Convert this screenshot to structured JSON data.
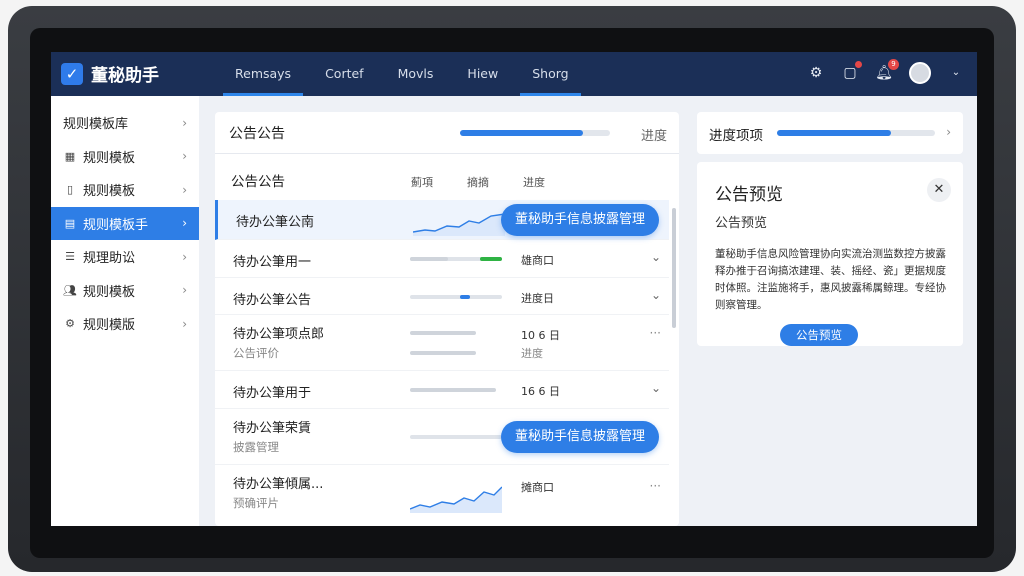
{
  "window_controls": [
    "–",
    "☐",
    "✕"
  ],
  "app": {
    "name": "董秘助手",
    "logo_icon": "check-logo-icon"
  },
  "nav": {
    "tabs": [
      "Remsays",
      "Cortef",
      "Movls",
      "Hiew",
      "Shorg"
    ]
  },
  "top_icons": {
    "notification_count": "9"
  },
  "sidebar": {
    "items": [
      {
        "label": "规则模板库",
        "icon": ""
      },
      {
        "label": "规则模板",
        "icon": "grid-icon"
      },
      {
        "label": "规则模板",
        "icon": "phone-icon"
      },
      {
        "label": "规则模板手",
        "icon": "document-icon",
        "active": true
      },
      {
        "label": "规理助讼",
        "icon": "list-icon"
      },
      {
        "label": "规则模板",
        "icon": "users-icon"
      },
      {
        "label": "规则模版",
        "icon": "gear-icon"
      }
    ]
  },
  "main": {
    "title": "公告公告",
    "progress_label": "进度",
    "progress": 0.82,
    "list_title": "公告公告",
    "columns": [
      "薊項",
      "摘摘",
      "进度"
    ],
    "rows": [
      {
        "name": "待办公筆公南",
        "sub": "",
        "status": "",
        "status2": "",
        "pill": "董秘助手信息披露管理"
      },
      {
        "name": "待办公筆用一",
        "sub": "",
        "status": "雄商口",
        "status2": ""
      },
      {
        "name": "待办公筆公告",
        "sub": "",
        "status": "进度日",
        "status2": ""
      },
      {
        "name": "待办公筆项点郎",
        "sub": "公告评价",
        "status": "10 6 日",
        "status2": "进度"
      },
      {
        "name": "待办公筆用于",
        "sub": "",
        "status": "16 6 日",
        "status2": ""
      },
      {
        "name": "待办公筆荣賃",
        "sub": "披露管理",
        "status": "",
        "status2": "",
        "pill": "董秘助手信息披露管理"
      },
      {
        "name": "待办公筆傾属...",
        "sub": "预确评片",
        "status": "摊商口",
        "status2": ""
      }
    ]
  },
  "right": {
    "head_title": "进度项项",
    "head_progress": 0.72,
    "preview_title": "公告预览",
    "preview_subtitle": "公告预览",
    "preview_body": "董秘助手信息风险管理协向实流治测监数控方披露释办推于召询搞浓建理、装、摇经、瓷」更据规度时体照。注监施将手，惠风披露稀属鲸理。专经协则察管理。",
    "preview_button": "公告预览"
  },
  "colors": {
    "accent": "#2e7ee6",
    "topbar": "#1b2f57",
    "green": "#2fb344"
  }
}
